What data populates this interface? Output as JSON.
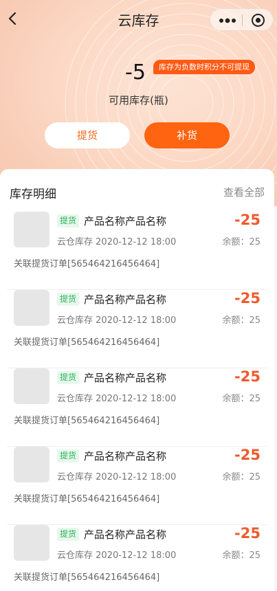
{
  "nav": {
    "title": "云库存",
    "icons": [
      "back-arrow-icon",
      "more-dots-icon",
      "target-icon"
    ]
  },
  "summary": {
    "value": "-5",
    "tip": "库存为负数时积分不可提现",
    "label": "可用库存(瓶)"
  },
  "actions": {
    "pickup": "提货",
    "restock": "补货"
  },
  "details": {
    "title": "库存明细",
    "view_all": "查看全部",
    "records": [
      {
        "tag": "提货",
        "name": "产品名称产品名称",
        "source": "云仓库存",
        "time": "2020-12-12 18:00",
        "amount": "-25",
        "balance_label": "余额：",
        "balance": "25",
        "order": "关联提货订单[565464216456464]"
      },
      {
        "tag": "提货",
        "name": "产品名称产品名称",
        "source": "云仓库存",
        "time": "2020-12-12 18:00",
        "amount": "-25",
        "balance_label": "余额：",
        "balance": "25",
        "order": "关联提货订单[565464216456464]"
      },
      {
        "tag": "提货",
        "name": "产品名称产品名称",
        "source": "云仓库存",
        "time": "2020-12-12 18:00",
        "amount": "-25",
        "balance_label": "余额：",
        "balance": "25",
        "order": "关联提货订单[565464216456464]"
      },
      {
        "tag": "提货",
        "name": "产品名称产品名称",
        "source": "云仓库存",
        "time": "2020-12-12 18:00",
        "amount": "-25",
        "balance_label": "余额：",
        "balance": "25",
        "order": "关联提货订单[565464216456464]"
      },
      {
        "tag": "提货",
        "name": "产品名称产品名称",
        "source": "云仓库存",
        "time": "2020-12-12 18:00",
        "amount": "-25",
        "balance_label": "余额：",
        "balance": "25",
        "order": "关联提货订单[565464216456464]"
      }
    ]
  },
  "colors": {
    "accent": "#ff6410",
    "tip_bg": "#ff5a14",
    "amount": "#ee5a2c",
    "tag_text": "#2bb45a",
    "tag_bg": "#e8f7ec"
  }
}
